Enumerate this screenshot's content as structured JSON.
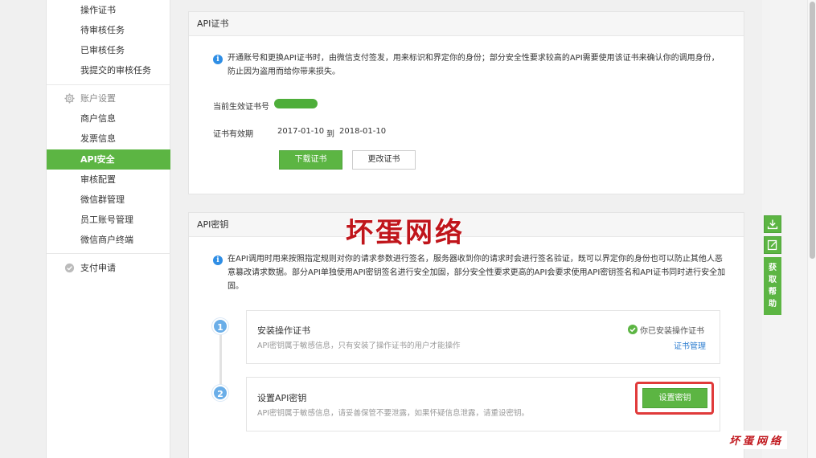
{
  "sidebar": {
    "items": [
      {
        "label": "操作证书"
      },
      {
        "label": "待审核任务"
      },
      {
        "label": "已审核任务"
      },
      {
        "label": "我提交的审核任务"
      }
    ],
    "group_account": {
      "label": "账户设置",
      "icon": "gear-icon"
    },
    "account_items": [
      {
        "label": "商户信息"
      },
      {
        "label": "发票信息"
      },
      {
        "label": "API安全",
        "active": true
      },
      {
        "label": "审核配置"
      },
      {
        "label": "微信群管理"
      },
      {
        "label": "员工账号管理"
      },
      {
        "label": "微信商户终端"
      }
    ],
    "group_pay": {
      "label": "支付申请",
      "icon": "pay-apply-icon"
    }
  },
  "api_cert": {
    "title": "API证书",
    "info": "开通账号和更换API证书时，由微信支付签发，用来标识和界定你的身份；部分安全性要求较高的API需要使用该证书来确认你的调用身份，防止因为盗用而给你带来损失。",
    "current_label": "当前生效证书号",
    "validity_label": "证书有效期",
    "validity_start": "2017-01-10",
    "validity_to": "到",
    "validity_end": "2018-01-10",
    "download_btn": "下载证书",
    "change_btn": "更改证书"
  },
  "api_key": {
    "title": "API密钥",
    "info": "在API调用时用来按照指定规则对你的请求参数进行签名，服务器收到你的请求时会进行签名验证，既可以界定你的身份也可以防止其他人恶意篡改请求数据。部分API单独使用API密钥签名进行安全加固，部分安全性要求更高的API会要求使用API密钥签名和API证书同时进行安全加固。",
    "steps": [
      {
        "num": "1",
        "title": "安装操作证书",
        "desc": "API密钥属于敏感信息，只有安装了操作证书的用户才能操作",
        "status": "你已安装操作证书",
        "link": "证书管理"
      },
      {
        "num": "2",
        "title": "设置API密钥",
        "desc": "API密钥属于敏感信息，请妥善保管不要泄露，如果怀疑信息泄露，请重设密钥。",
        "button": "设置密钥"
      }
    ]
  },
  "watermark": {
    "big": "坏蛋网络",
    "small": "坏蛋网络"
  },
  "help": {
    "label": "获取帮助"
  },
  "colors": {
    "accent": "#5cb543",
    "info": "#2f8ee5",
    "highlight": "#e03a3a",
    "watermark": "#c0151b"
  }
}
